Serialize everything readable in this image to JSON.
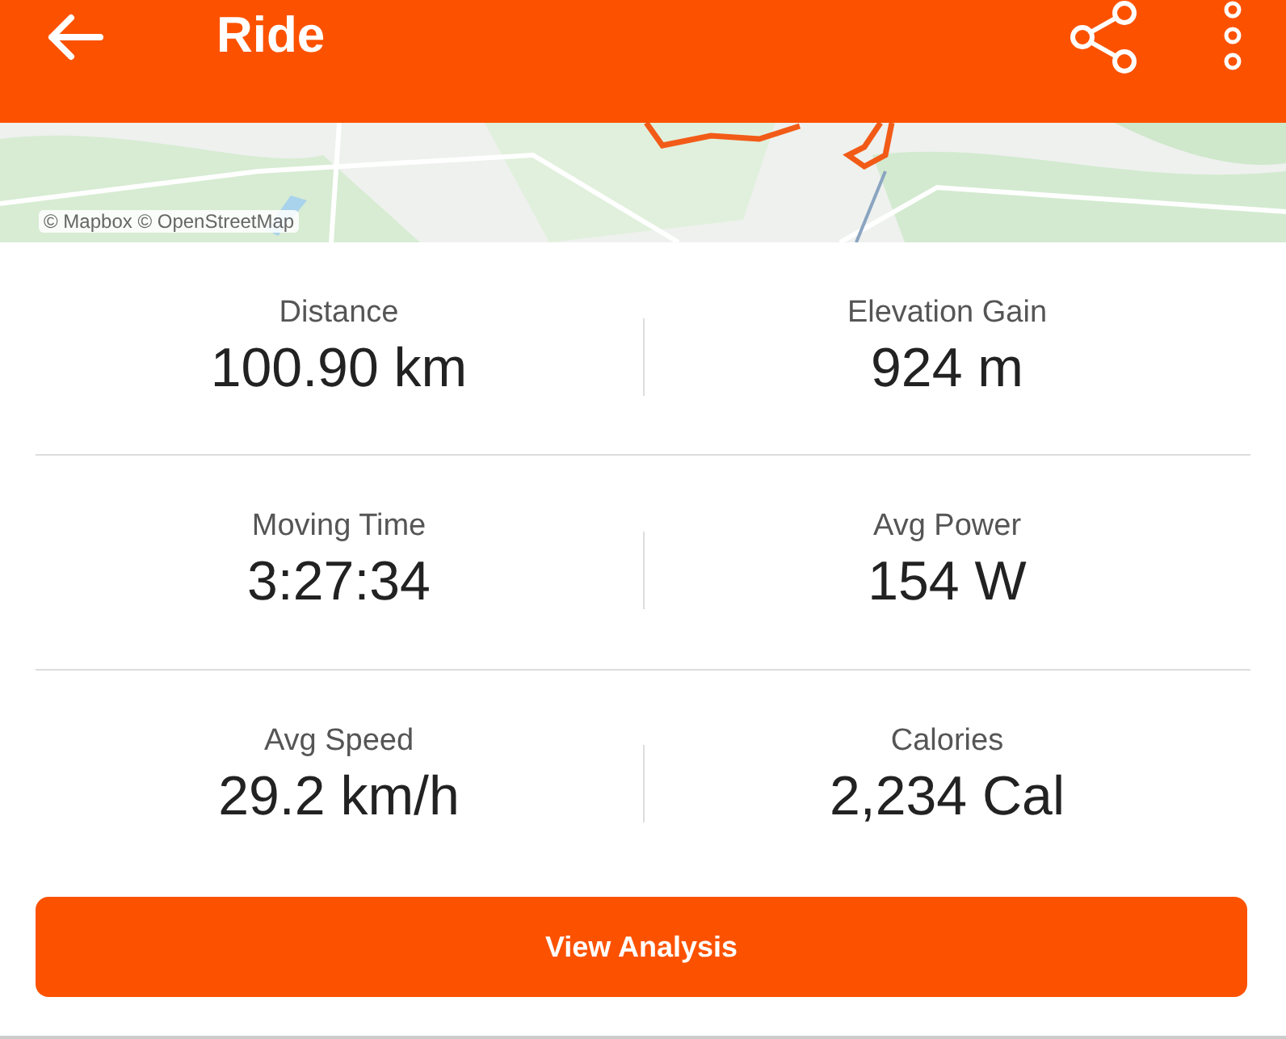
{
  "header": {
    "title": "Ride"
  },
  "map": {
    "kind": "picture",
    "attribution": "© Mapbox © OpenStreetMap"
  },
  "stats": [
    [
      {
        "label": "Distance",
        "value": "100.90 km"
      },
      {
        "label": "Elevation Gain",
        "value": "924 m"
      }
    ],
    [
      {
        "label": "Moving Time",
        "value": "3:27:34"
      },
      {
        "label": "Avg Power",
        "value": "154 W"
      }
    ],
    [
      {
        "label": "Avg Speed",
        "value": "29.2 km/h"
      },
      {
        "label": "Calories",
        "value": "2,234 Cal"
      }
    ]
  ],
  "button": "View Analysis"
}
